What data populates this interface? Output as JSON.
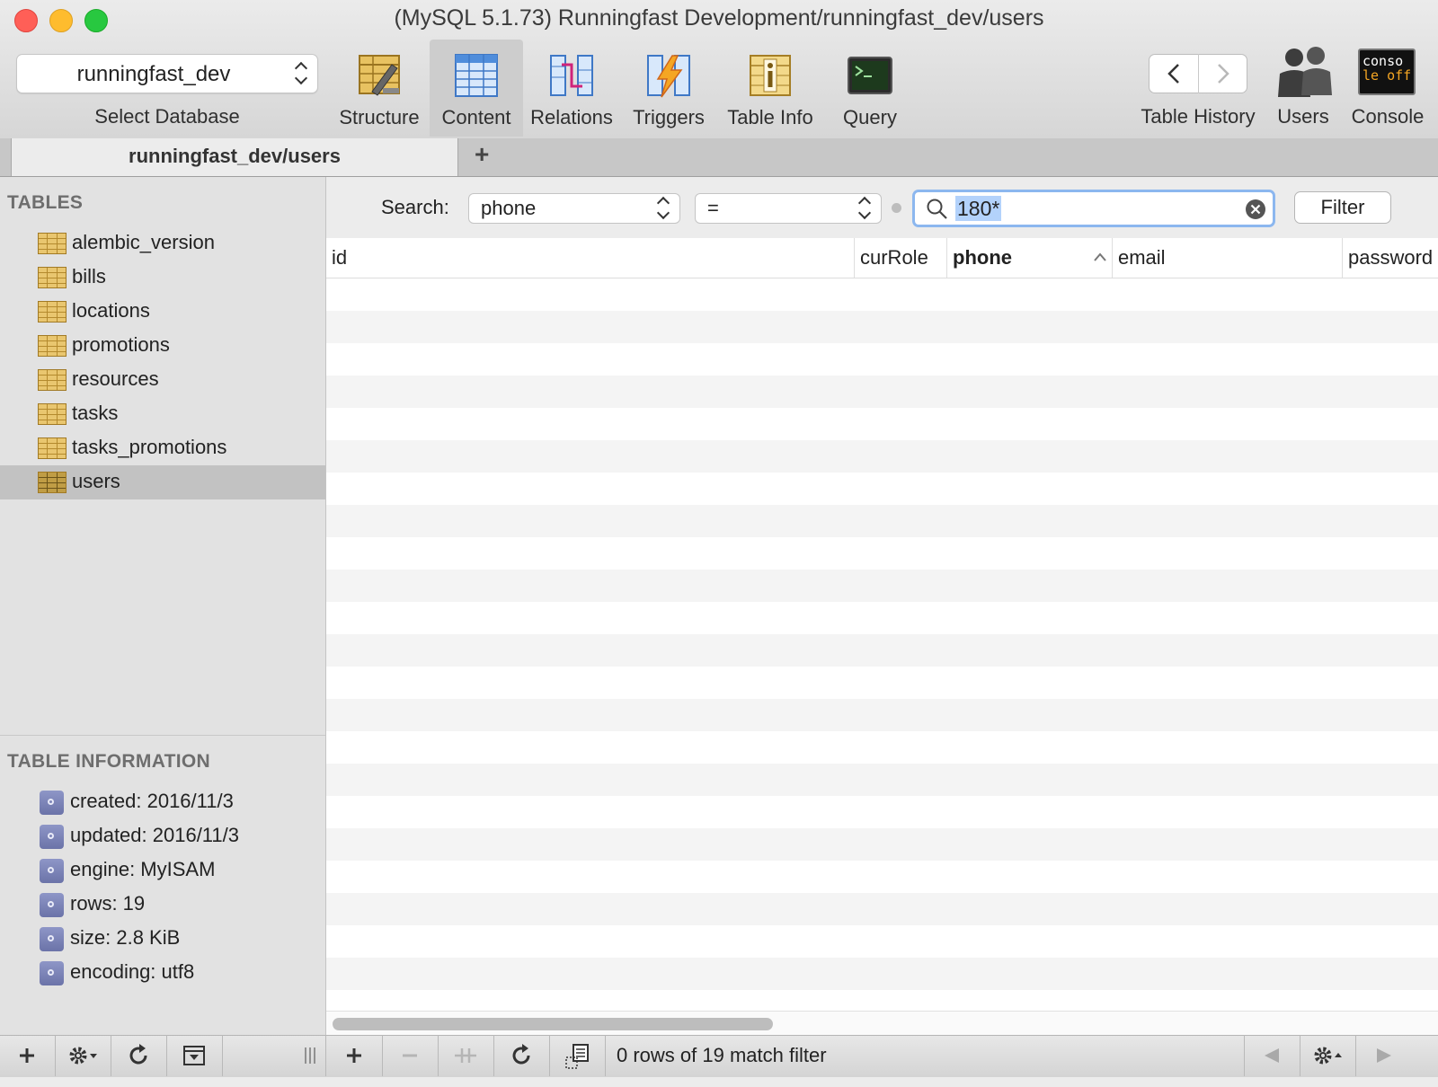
{
  "window": {
    "title": "(MySQL 5.1.73) Runningfast Development/runningfast_dev/users",
    "traffic_colors": [
      "#ff5f57",
      "#febc2e",
      "#28c840"
    ]
  },
  "toolbar": {
    "database": "runningfast_dev",
    "database_label": "Select Database",
    "tools": [
      {
        "label": "Structure",
        "icon": "structure-icon"
      },
      {
        "label": "Content",
        "icon": "content-icon",
        "active": true
      },
      {
        "label": "Relations",
        "icon": "relations-icon"
      },
      {
        "label": "Triggers",
        "icon": "triggers-icon"
      },
      {
        "label": "Table Info",
        "icon": "table-info-icon"
      },
      {
        "label": "Query",
        "icon": "query-icon"
      }
    ],
    "history_label": "Table History",
    "users_label": "Users",
    "console_label": "Console",
    "console_icon_text": [
      "conso",
      "le off"
    ]
  },
  "tabs": {
    "active": "runningfast_dev/users",
    "add": "+"
  },
  "sidebar": {
    "tables_heading": "TABLES",
    "tables": [
      "alembic_version",
      "bills",
      "locations",
      "promotions",
      "resources",
      "tasks",
      "tasks_promotions",
      "users"
    ],
    "selected_table": "users",
    "info_heading": "TABLE INFORMATION",
    "info": [
      "created: 2016/11/3",
      "updated: 2016/11/3",
      "engine: MyISAM",
      "rows: 19",
      "size: 2.8 KiB",
      "encoding: utf8"
    ]
  },
  "filter": {
    "search_label": "Search:",
    "field": "phone",
    "operator": "=",
    "value": "180*",
    "button": "Filter"
  },
  "grid": {
    "columns": [
      "id",
      "curRole",
      "phone",
      "email",
      "password"
    ],
    "sorted_column": "phone"
  },
  "bottom": {
    "status": "0 rows of 19 match filter"
  }
}
